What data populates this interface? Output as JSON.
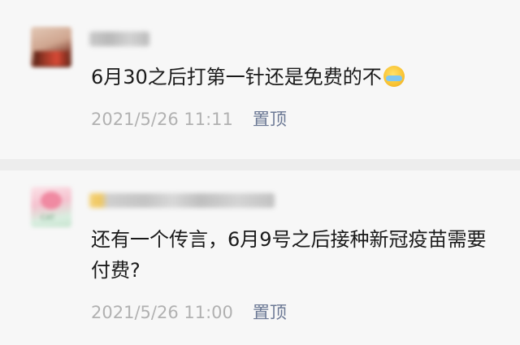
{
  "comments": [
    {
      "text": "6月30之后打第一针还是免费的不",
      "emoji": "laughing-crying-emoji",
      "timestamp": "2021/5/26 11:11",
      "action_label": "置顶"
    },
    {
      "text": "还有一个传言，6月9号之后接种新冠疫苗需要付费?",
      "timestamp": "2021/5/26 11:00",
      "action_label": "置顶"
    }
  ]
}
